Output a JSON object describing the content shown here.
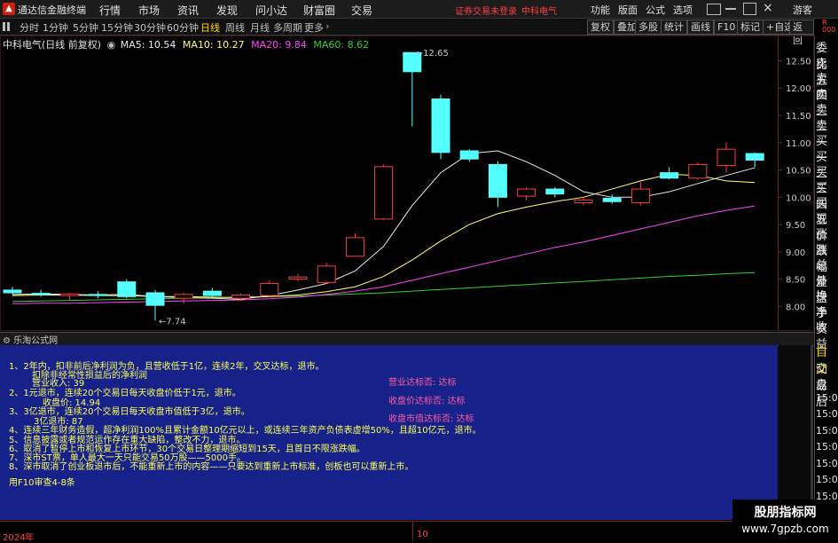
{
  "titlebar": {
    "app_title": "通达信金融终端",
    "menus": [
      "行情",
      "市场",
      "资讯",
      "发现",
      "问小达",
      "财富圈",
      "交易"
    ],
    "status_text": "证券交易未登录",
    "stock_name": "中科电气",
    "right_buttons": [
      "功能",
      "版面",
      "公式",
      "选项",
      "游客"
    ]
  },
  "toolbar": {
    "periods": [
      "分时",
      "1分钟",
      "5分钟",
      "15分钟",
      "30分钟",
      "60分钟",
      "日线",
      "周线",
      "月线",
      "多周期",
      "更多"
    ],
    "active_period": "日线",
    "right_buttons": [
      "复权",
      "叠加",
      "多股",
      "统计",
      "画线",
      "F10",
      "标记",
      "+自选",
      "返回"
    ]
  },
  "chart": {
    "title": "中科电气(日线 前复权)",
    "ma5": "MA5: 10.54",
    "ma10": "MA10: 10.27",
    "ma20": "MA20: 9.84",
    "ma60": "MA60: 8.62",
    "high_label": "12.65",
    "low_label": "7.74",
    "date_start": "2024年",
    "date_mid": "10",
    "colors": {
      "up": "#ff3b3b",
      "down": "#54ffff",
      "ma5": "#e8e8e8",
      "ma10": "#ffff66",
      "ma20": "#ff40ff",
      "ma60": "#30d030"
    }
  },
  "chart_data": {
    "type": "candlestick",
    "yticks": [
      "12.50",
      "12.00",
      "11.50",
      "11.00",
      "10.50",
      "10.00",
      "9.50",
      "9.00",
      "8.50",
      "8.00"
    ],
    "ylim": [
      7.6,
      12.8
    ],
    "candles": [
      {
        "o": 8.3,
        "h": 8.36,
        "l": 8.22,
        "c": 8.25
      },
      {
        "o": 8.24,
        "h": 8.3,
        "l": 8.18,
        "c": 8.22
      },
      {
        "o": 8.2,
        "h": 8.25,
        "l": 8.12,
        "c": 8.23
      },
      {
        "o": 8.22,
        "h": 8.28,
        "l": 8.15,
        "c": 8.2
      },
      {
        "o": 8.45,
        "h": 8.5,
        "l": 8.15,
        "c": 8.18
      },
      {
        "o": 8.25,
        "h": 8.3,
        "l": 7.74,
        "c": 8.02
      },
      {
        "o": 8.15,
        "h": 8.25,
        "l": 8.05,
        "c": 8.22
      },
      {
        "o": 8.28,
        "h": 8.34,
        "l": 8.18,
        "c": 8.2
      },
      {
        "o": 8.15,
        "h": 8.24,
        "l": 8.1,
        "c": 8.21
      },
      {
        "o": 8.2,
        "h": 8.48,
        "l": 8.18,
        "c": 8.42
      },
      {
        "o": 8.5,
        "h": 8.6,
        "l": 8.46,
        "c": 8.54
      },
      {
        "o": 8.44,
        "h": 8.8,
        "l": 8.42,
        "c": 8.74
      },
      {
        "o": 8.92,
        "h": 9.34,
        "l": 8.92,
        "c": 9.26
      },
      {
        "o": 9.6,
        "h": 10.6,
        "l": 9.58,
        "c": 10.56
      },
      {
        "o": 12.65,
        "h": 12.65,
        "l": 11.3,
        "c": 12.3
      },
      {
        "o": 11.8,
        "h": 11.88,
        "l": 10.7,
        "c": 10.82
      },
      {
        "o": 10.85,
        "h": 10.88,
        "l": 10.65,
        "c": 10.7
      },
      {
        "o": 10.6,
        "h": 10.66,
        "l": 9.82,
        "c": 10.0
      },
      {
        "o": 10.02,
        "h": 10.18,
        "l": 9.95,
        "c": 10.15
      },
      {
        "o": 10.15,
        "h": 10.18,
        "l": 10.0,
        "c": 10.06
      },
      {
        "o": 9.9,
        "h": 10.0,
        "l": 9.85,
        "c": 9.95
      },
      {
        "o": 9.98,
        "h": 10.05,
        "l": 9.88,
        "c": 9.92
      },
      {
        "o": 9.9,
        "h": 10.3,
        "l": 9.85,
        "c": 10.15
      },
      {
        "o": 10.45,
        "h": 10.55,
        "l": 10.33,
        "c": 10.35
      },
      {
        "o": 10.35,
        "h": 10.64,
        "l": 10.32,
        "c": 10.6
      },
      {
        "o": 10.58,
        "h": 11.0,
        "l": 10.45,
        "c": 10.88
      },
      {
        "o": 10.8,
        "h": 10.82,
        "l": 10.55,
        "c": 10.68
      }
    ],
    "ma5": [
      8.22,
      8.23,
      8.22,
      8.21,
      8.22,
      8.18,
      8.16,
      8.15,
      8.13,
      8.2,
      8.3,
      8.42,
      8.65,
      9.1,
      9.85,
      10.45,
      10.8,
      10.85,
      10.65,
      10.4,
      10.1,
      10.0,
      10.0,
      10.1,
      10.25,
      10.4,
      10.54
    ],
    "ma10": [
      8.2,
      8.21,
      8.21,
      8.2,
      8.2,
      8.18,
      8.18,
      8.17,
      8.16,
      8.18,
      8.21,
      8.27,
      8.36,
      8.55,
      8.85,
      9.2,
      9.5,
      9.7,
      9.82,
      9.92,
      10.0,
      10.15,
      10.3,
      10.42,
      10.4,
      10.3,
      10.27
    ],
    "ma20": [
      8.05,
      8.06,
      8.06,
      8.07,
      8.08,
      8.09,
      8.1,
      8.11,
      8.12,
      8.14,
      8.17,
      8.22,
      8.28,
      8.36,
      8.48,
      8.6,
      8.72,
      8.84,
      8.96,
      9.08,
      9.18,
      9.3,
      9.42,
      9.54,
      9.66,
      9.76,
      9.84
    ],
    "ma60": [
      8.09,
      8.1,
      8.11,
      8.12,
      8.13,
      8.14,
      8.15,
      8.16,
      8.17,
      8.18,
      8.19,
      8.21,
      8.23,
      8.25,
      8.28,
      8.31,
      8.34,
      8.37,
      8.4,
      8.43,
      8.46,
      8.49,
      8.52,
      8.55,
      8.57,
      8.6,
      8.62
    ]
  },
  "side_items": [
    "委比",
    "卖五",
    "卖四",
    "卖三",
    "卖二",
    "卖一",
    "买一",
    "买二",
    "买三",
    "买四",
    "买五",
    "现价",
    "涨跌",
    "涨幅",
    "总量",
    "外盘",
    "换手",
    "净资",
    "收益"
  ],
  "side_lower": [
    "自动",
    "交易",
    "盘后",
    "15:00",
    "15:00",
    "15:00",
    "15:00",
    "15:00",
    "15:00",
    "15:00",
    "15:00"
  ],
  "formula": {
    "panel_title": "乐淘公式网",
    "lines": [
      "1、2年内，扣非前后净利润为负，且营收低于1亿，连续2年，交叉达标，退市。",
      "扣除非经常性损益后的净利润",
      "营业收入: 39",
      "2、1元退市，连续20个交易日每天收盘价低于1元，退市。",
      "收盘价: 14.94",
      "3、3亿退市，连续20个交易日每天收盘市值低于3亿，退市。",
      "3亿退市: 87",
      "4、连续三年财务造假，超净利润100%且累计金额10亿元以上，或连续三年资产负债表虚增50%，且超10亿元，退市。",
      "5、信息披露或者规范运作存在重大缺陷，整改不力，退市。",
      "6、取消了暂停上市和恢复上市环节，30个交易日整理期缩短到15天，且首日不限涨跌幅。",
      "7、深市ST票，单人最大一天只能交易50万股——5000手。",
      "8、深市取消了创业板退市后，不能重新上市的内容——只要达到重新上市标准，创板也可以重新上市。",
      "用F10审查4-8条"
    ],
    "status": [
      "营业达标否: 达标",
      "收盘价达标否: 达标",
      "收盘市值达标否: 达标"
    ]
  },
  "watermark": {
    "title": "股朋指标网",
    "url": "www.7gpzb.com"
  }
}
